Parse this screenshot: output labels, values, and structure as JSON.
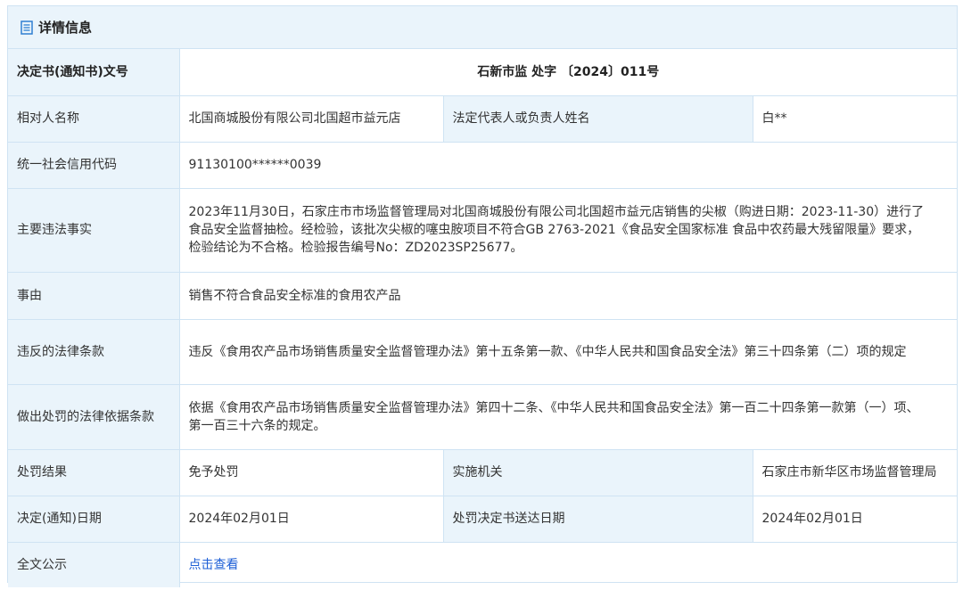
{
  "header": {
    "icon": "document-icon",
    "title": "详情信息"
  },
  "rows": {
    "decision_no": {
      "label": "决定书(通知书)文号",
      "value": "石新市监 处字 〔2024〕011号"
    },
    "party": {
      "label": "相对人名称",
      "value": "北国商城股份有限公司北国超市益元店",
      "sub_label": "法定代表人或负责人姓名",
      "sub_value": "白**"
    },
    "credit_code": {
      "label": "统一社会信用代码",
      "value": "91130100******0039"
    },
    "facts": {
      "label": "主要违法事实",
      "value": "2023年11月30日，石家庄市市场监督管理局对北国商城股份有限公司北国超市益元店销售的尖椒（购进日期：2023-11-30）进行了食品安全监督抽检。经检验，该批次尖椒的噻虫胺项目不符合GB 2763-2021《食品安全国家标准 食品中农药最大残留限量》要求，检验结论为不合格。检验报告编号No：ZD2023SP25677。"
    },
    "reason": {
      "label": "事由",
      "value": "销售不符合食品安全标准的食用农产品"
    },
    "violated_law": {
      "label": "违反的法律条款",
      "value": "违反《食用农产品市场销售质量安全监督管理办法》第十五条第一款、《中华人民共和国食品安全法》第三十四条第（二）项的规定"
    },
    "legal_basis": {
      "label": "做出处罚的法律依据条款",
      "value": "依据《食用农产品市场销售质量安全监督管理办法》第四十二条、《中华人民共和国食品安全法》第一百二十四条第一款第（一）项、第一百三十六条的规定。"
    },
    "result": {
      "label": "处罚结果",
      "value": "免予处罚",
      "sub_label": "实施机关",
      "sub_value": "石家庄市新华区市场监督管理局"
    },
    "date": {
      "label": "决定(通知)日期",
      "value": "2024年02月01日",
      "sub_label": "处罚决定书送达日期",
      "sub_value": "2024年02月01日"
    },
    "full_text": {
      "label": "全文公示",
      "link_text": "点击查看"
    }
  },
  "colors": {
    "border": "#cfe3f3",
    "label_bg": "#eaf4fb",
    "link": "#1e5fd6"
  }
}
